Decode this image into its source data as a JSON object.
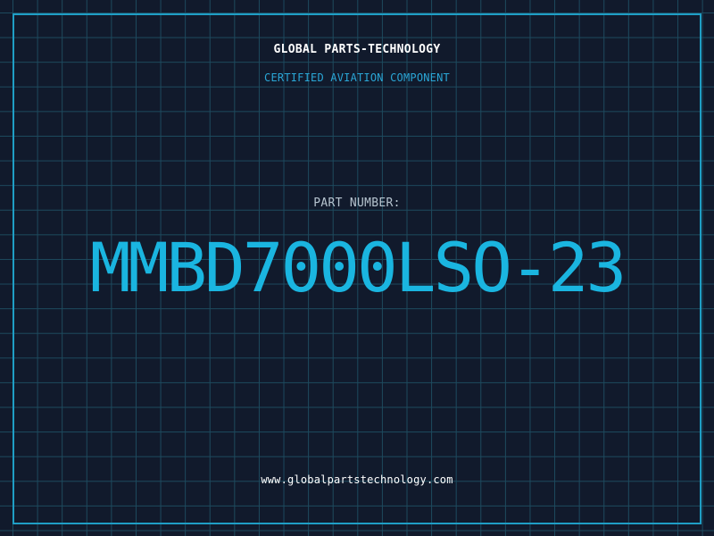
{
  "header": {
    "company": "GLOBAL PARTS-TECHNOLOGY",
    "tagline": "CERTIFIED AVIATION COMPONENT"
  },
  "main": {
    "part_number_label": "PART NUMBER:",
    "part_number": "MMBD7000LSO-23"
  },
  "footer": {
    "website": "www.globalpartstechnology.com"
  },
  "colors": {
    "background": "#111a2c",
    "grid": "#1d4a5e",
    "accent": "#1ab5e0",
    "frame": "#1f9ec5"
  }
}
